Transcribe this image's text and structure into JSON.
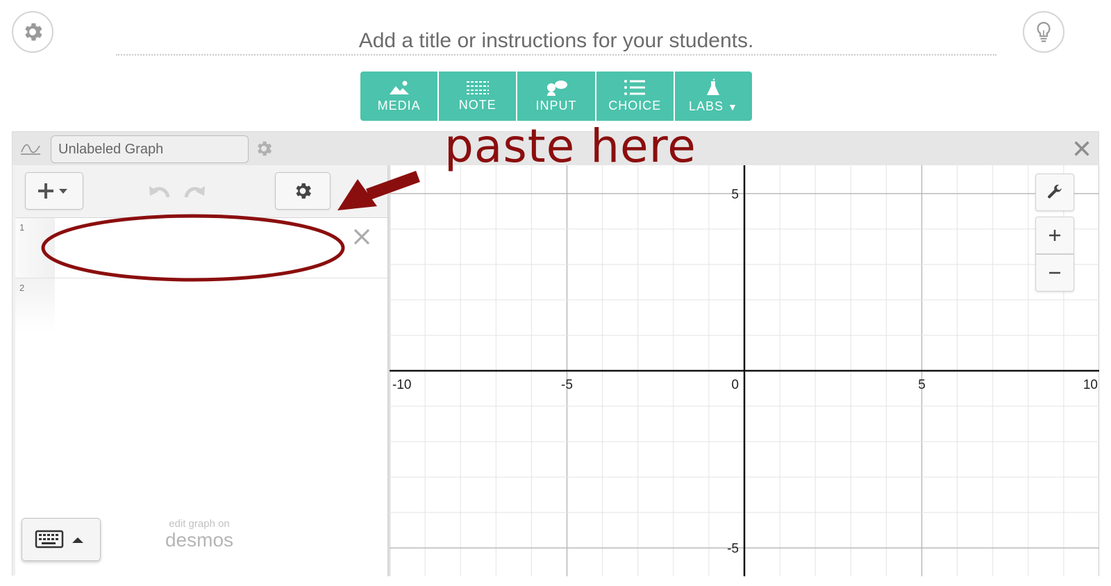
{
  "header": {
    "title_placeholder": "Add a title or instructions for your students.",
    "settings_icon": "gear-icon",
    "hint_icon": "lightbulb-icon"
  },
  "toolbar": {
    "accent_color": "#4cc3ac",
    "items": [
      {
        "label": "MEDIA",
        "icon": "image-icon"
      },
      {
        "label": "NOTE",
        "icon": "note-icon"
      },
      {
        "label": "INPUT",
        "icon": "speech-bubbles-icon"
      },
      {
        "label": "CHOICE",
        "icon": "list-icon"
      },
      {
        "label": "LABS",
        "icon": "flask-icon",
        "dropdown": true
      }
    ]
  },
  "graph_card": {
    "name": "Unlabeled Graph",
    "type_icon": "graph-wave-icon"
  },
  "expression_list": {
    "rows": [
      {
        "index": "1",
        "value": ""
      },
      {
        "index": "2",
        "value": ""
      }
    ],
    "footer": {
      "edit_text": "edit graph on",
      "brand": "desmos"
    }
  },
  "graph_axes": {
    "x_ticks": [
      "-10",
      "-5",
      "0",
      "5",
      "10"
    ],
    "y_ticks": [
      "5",
      "-5"
    ],
    "x_range": [
      -10,
      10
    ],
    "y_range": [
      -5.8,
      5.8
    ],
    "grid": true
  },
  "annotation": {
    "text": "paste here",
    "color": "#8b0e0e"
  }
}
